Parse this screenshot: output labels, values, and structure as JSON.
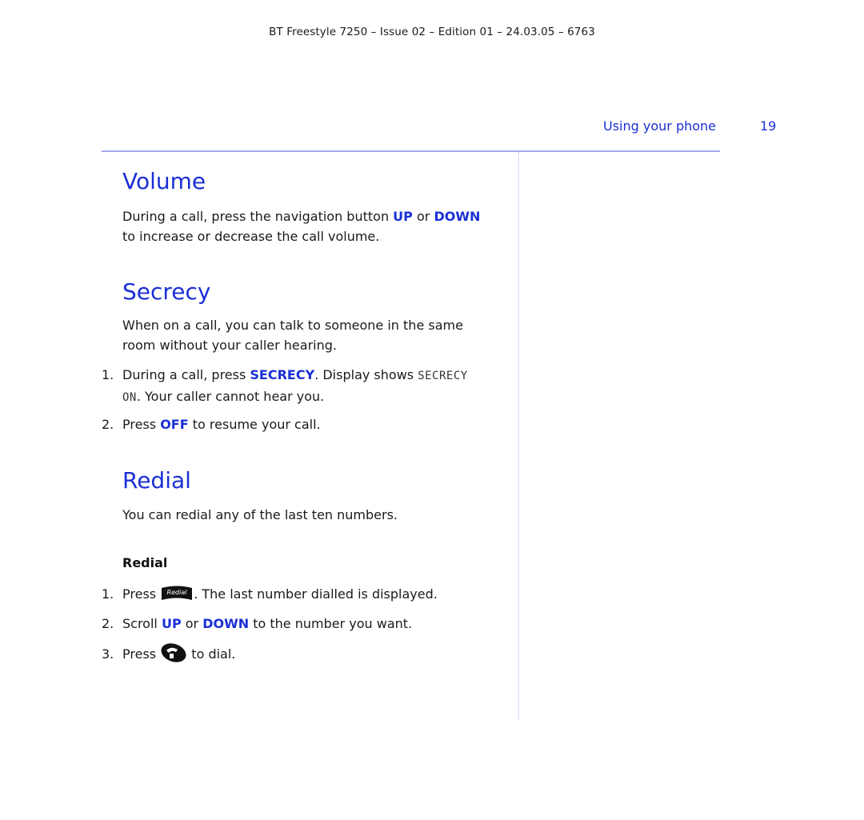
{
  "header": {
    "doc_info": "BT Freestyle 7250 – Issue 02 – Edition 01 – 24.03.05 – 6763",
    "section_title": "Using your phone",
    "page_number": "19"
  },
  "colors": {
    "accent": "#1a2fd6",
    "rule": "#a8a8ec",
    "text": "#1a1a1a"
  },
  "volume": {
    "heading": "Volume",
    "text_1": "During a call, press the navigation button ",
    "kw_up": "UP",
    "text_or": " or ",
    "kw_down": "DOWN",
    "text_2": "to increase or decrease the call volume."
  },
  "secrecy": {
    "heading": "Secrecy",
    "intro_line1": "When on a call, you can talk to someone in the same",
    "intro_line2": "room without your caller hearing.",
    "steps": [
      {
        "num": "1.",
        "text_a": "During a call, press ",
        "kw": "SECRECY",
        "text_b": ". Display shows ",
        "lcd_a": "SECRECY",
        "lcd_b": "ON",
        "text_c": ". Your caller cannot hear you."
      },
      {
        "num": "2.",
        "text_a": "Press ",
        "kw": "OFF",
        "text_b": " to resume your call."
      }
    ]
  },
  "redial": {
    "heading": "Redial",
    "intro": "You can redial any of the last ten numbers.",
    "subheading": "Redial",
    "steps": [
      {
        "num": "1.",
        "text_a": "Press ",
        "icon": "redial-key-icon",
        "key_label": "Redial",
        "text_b": ". The last number dialled is displayed."
      },
      {
        "num": "2.",
        "text_a": "Scroll ",
        "kw_up": "UP",
        "text_or": " or ",
        "kw_down": "DOWN",
        "text_b": " to the number you want."
      },
      {
        "num": "3.",
        "text_a": "Press ",
        "icon": "talk-key-icon",
        "text_b": " to dial."
      }
    ]
  }
}
